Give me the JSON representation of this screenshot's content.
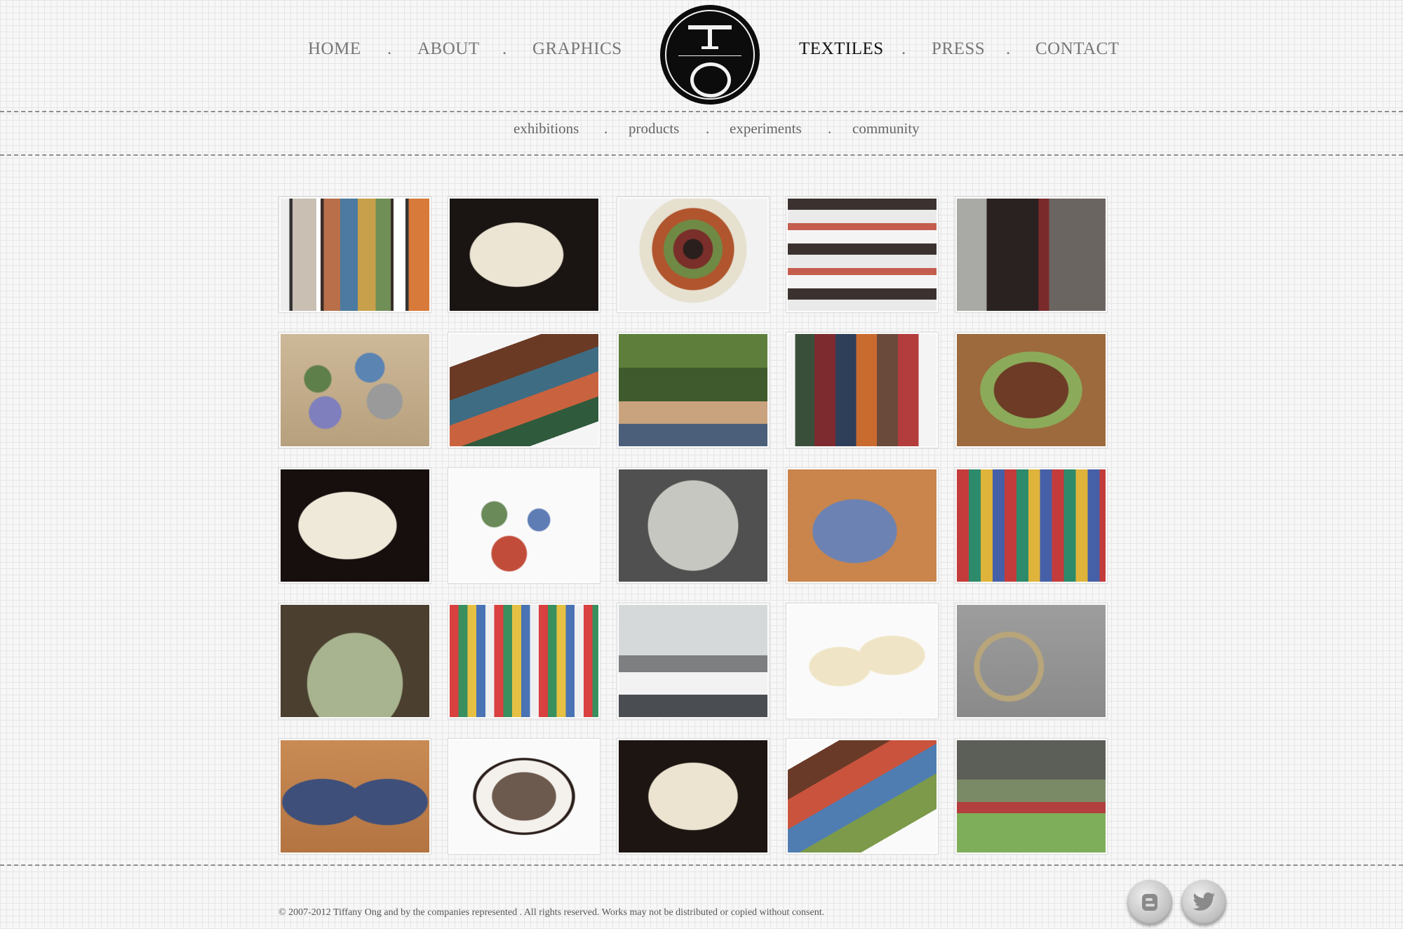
{
  "nav": {
    "left": [
      "HOME",
      "ABOUT",
      "GRAPHICS"
    ],
    "right": [
      "TEXTILES",
      "PRESS",
      "CONTACT"
    ],
    "separator": ".",
    "active": "TEXTILES"
  },
  "logo": {
    "letters": "TO"
  },
  "subnav": {
    "items": [
      "exhibitions",
      "products",
      "experiments",
      "community"
    ],
    "separator": "."
  },
  "gallery": {
    "rows": 5,
    "columns": 5,
    "items": [
      "framed-yarn-exhibition",
      "cream-knit-clutch",
      "layered-yarn-disc",
      "jar-shelves-display",
      "yarn-in-glass-jar",
      "felted-pebbles-mat",
      "striped-crochet-pouch",
      "women-in-forest",
      "colorful-knit-row",
      "green-crochet-pouch",
      "white-knit-wrap",
      "small-knit-samples",
      "white-doily-globe",
      "blue-crochet-purse",
      "yarn-swatch-installation",
      "green-knit-basket",
      "yarn-swatch-tables",
      "workshop-classroom",
      "cream-baby-shoes",
      "lace-wall-pieces",
      "button-knit-slippers",
      "framed-knit-piece",
      "cream-knit-case",
      "patchwork-crochet-clutch",
      "village-group-photo"
    ]
  },
  "footer": {
    "copyright": "© 2007-2012 Tiffany Ong and by the companies represented . All rights reserved. Works may not be distributed or copied without consent."
  },
  "social": {
    "icons": [
      "blogger-icon",
      "twitter-icon"
    ]
  },
  "colors": {
    "background": "#f7f7f7",
    "grid": "#e6e6e6",
    "nav": "#777777",
    "nav_active": "#111111",
    "logo": "#0c0c0c"
  }
}
